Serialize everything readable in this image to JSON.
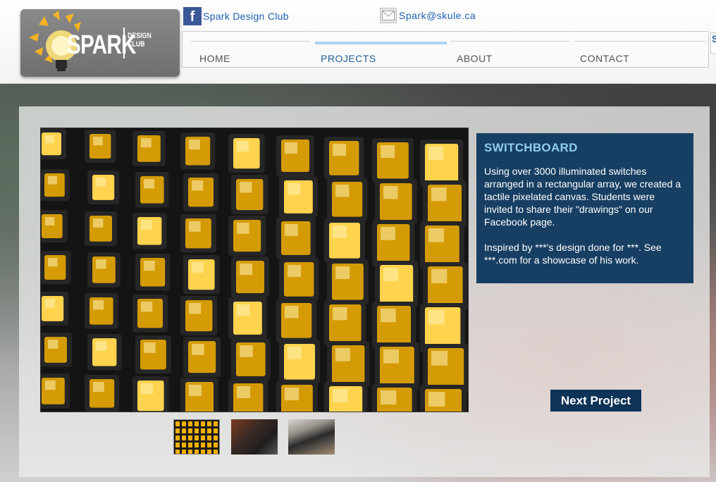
{
  "header": {
    "logo": {
      "main": "SPARK",
      "sub_line1": "DESIGN",
      "sub_line2": "CLUB",
      "icon": "lightbulb-burst-logo"
    },
    "facebook": {
      "icon": "facebook-icon",
      "label": "Spark Design Club"
    },
    "email": {
      "icon": "mail-icon",
      "label": "Spark@skule.ca"
    }
  },
  "nav": {
    "items": [
      {
        "label": "HOME",
        "active": false
      },
      {
        "label": "PROJECTS",
        "active": true
      },
      {
        "label": "ABOUT",
        "active": false
      },
      {
        "label": "CONTACT",
        "active": false
      }
    ],
    "overflow_glyph": "S"
  },
  "project": {
    "title": "SWITCHBOARD",
    "paragraphs": [
      "Using over 3000 illuminated switches arranged in a rectangular array, we created a tactile pixelated canvas. Students were invited to share their \"drawings\" on our Facebook page.",
      "Inspired by ***'s design done for ***. See ***.com for a showcase of his work."
    ],
    "next_label": "Next Project",
    "thumbnails": [
      "thumbnail-switch-grid",
      "thumbnail-switchboard-side",
      "thumbnail-students-building"
    ]
  },
  "colors": {
    "accent": "#1f5e9c",
    "panel": "#173f63",
    "title": "#8fcbf0",
    "button": "#0f3357",
    "switch_glow": "#f5b000"
  }
}
